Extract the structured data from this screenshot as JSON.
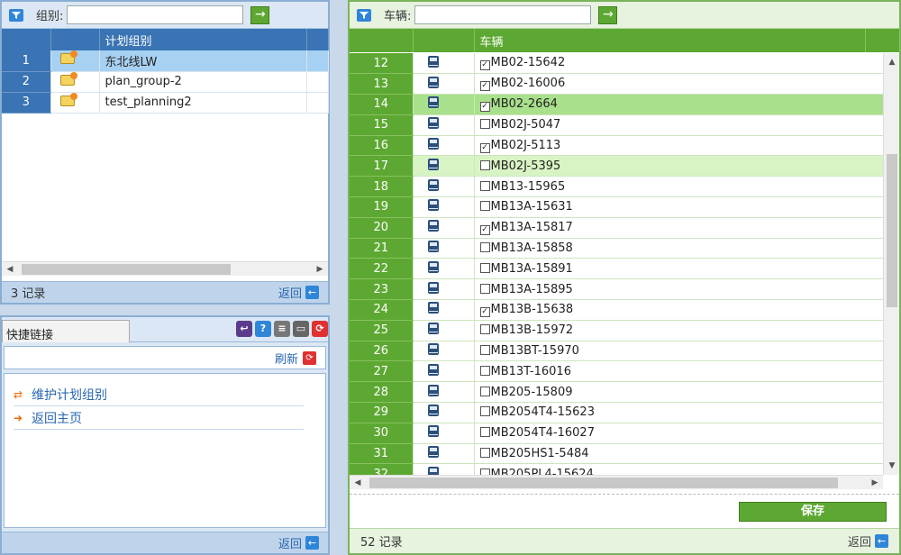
{
  "left_grid": {
    "filter_label": "组别:",
    "filter_value": "",
    "go_label": "→",
    "columns": [
      "",
      "",
      "计划组别"
    ],
    "rows": [
      {
        "num": "1",
        "name": "东北线LW",
        "selected": true
      },
      {
        "num": "2",
        "name": "plan_group-2",
        "selected": false
      },
      {
        "num": "3",
        "name": "test_planning2",
        "selected": false
      }
    ],
    "record_count": "3 记录",
    "back_label": "返回",
    "back_icon": "←"
  },
  "quick_links": {
    "tab_label": "快捷链接",
    "tools": [
      {
        "name": "return-icon",
        "glyph": "↩",
        "color": "#5b3b8c"
      },
      {
        "name": "help-icon",
        "glyph": "?",
        "color": "#2f86d8"
      },
      {
        "name": "notes-icon",
        "glyph": "≡",
        "color": "#777777"
      },
      {
        "name": "minimize-icon",
        "glyph": "▭",
        "color": "#666666"
      },
      {
        "name": "refresh-icon",
        "glyph": "⟳",
        "color": "#e03030"
      }
    ],
    "refresh_label": "刷新",
    "links": [
      {
        "label": "维护计划组别",
        "icon": "⇄"
      },
      {
        "label": "返回主页",
        "icon": "➜"
      }
    ],
    "back_label": "返回",
    "back_icon": "←"
  },
  "vehicle_grid": {
    "filter_label": "车辆:",
    "filter_value": "",
    "go_label": "→",
    "columns": [
      "",
      "",
      "车辆"
    ],
    "rows": [
      {
        "num": "12",
        "vehicle": "MB02-15642",
        "checked": true,
        "state": ""
      },
      {
        "num": "13",
        "vehicle": "MB02-16006",
        "checked": true,
        "state": ""
      },
      {
        "num": "14",
        "vehicle": "MB02-2664",
        "checked": true,
        "state": "sel"
      },
      {
        "num": "15",
        "vehicle": "MB02J-5047",
        "checked": false,
        "state": ""
      },
      {
        "num": "16",
        "vehicle": "MB02J-5113",
        "checked": true,
        "state": ""
      },
      {
        "num": "17",
        "vehicle": "MB02J-5395",
        "checked": false,
        "state": "hl"
      },
      {
        "num": "18",
        "vehicle": "MB13-15965",
        "checked": false,
        "state": ""
      },
      {
        "num": "19",
        "vehicle": "MB13A-15631",
        "checked": false,
        "state": ""
      },
      {
        "num": "20",
        "vehicle": "MB13A-15817",
        "checked": true,
        "state": ""
      },
      {
        "num": "21",
        "vehicle": "MB13A-15858",
        "checked": false,
        "state": ""
      },
      {
        "num": "22",
        "vehicle": "MB13A-15891",
        "checked": false,
        "state": ""
      },
      {
        "num": "23",
        "vehicle": "MB13A-15895",
        "checked": false,
        "state": ""
      },
      {
        "num": "24",
        "vehicle": "MB13B-15638",
        "checked": true,
        "state": ""
      },
      {
        "num": "25",
        "vehicle": "MB13B-15972",
        "checked": false,
        "state": ""
      },
      {
        "num": "26",
        "vehicle": "MB13BT-15970",
        "checked": false,
        "state": ""
      },
      {
        "num": "27",
        "vehicle": "MB13T-16016",
        "checked": false,
        "state": ""
      },
      {
        "num": "28",
        "vehicle": "MB205-15809",
        "checked": false,
        "state": ""
      },
      {
        "num": "29",
        "vehicle": "MB2054T4-15623",
        "checked": false,
        "state": ""
      },
      {
        "num": "30",
        "vehicle": "MB2054T4-16027",
        "checked": false,
        "state": ""
      },
      {
        "num": "31",
        "vehicle": "MB205HS1-5484",
        "checked": false,
        "state": ""
      },
      {
        "num": "32",
        "vehicle": "MB205PL4-15624",
        "checked": false,
        "state": ""
      }
    ],
    "save_label": "保存",
    "record_count": "52 记录",
    "back_label": "返回",
    "back_icon": "←"
  }
}
